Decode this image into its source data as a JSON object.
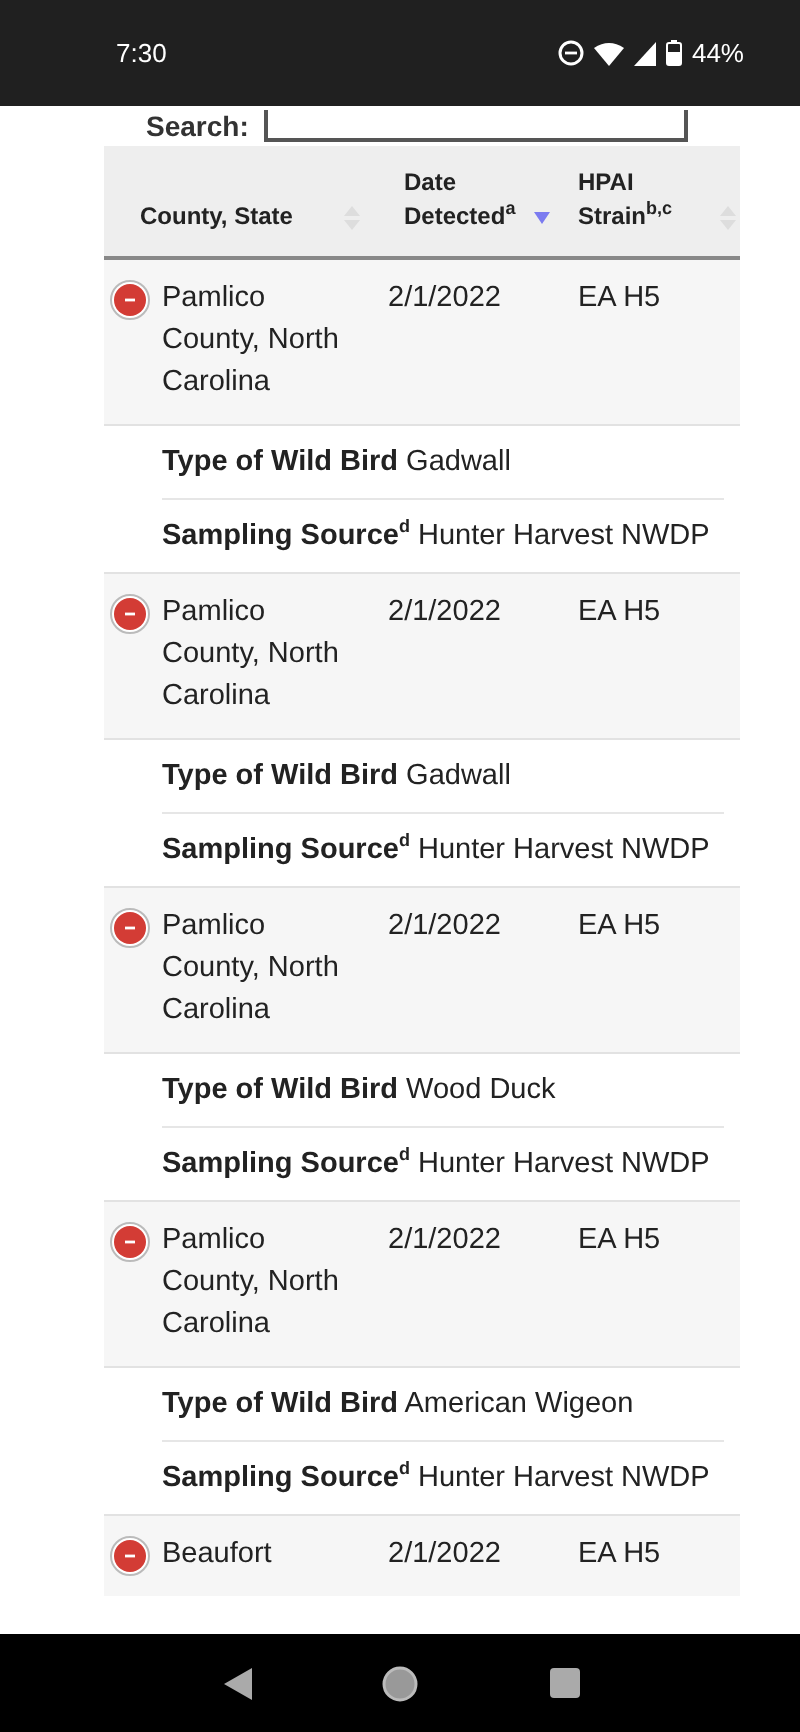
{
  "status_bar": {
    "time": "7:30",
    "battery": "44%"
  },
  "search": {
    "label": "Search:"
  },
  "table": {
    "columns": [
      {
        "label": "County, State",
        "sorted": false
      },
      {
        "label": "Date Detected$^{a}$",
        "sorted": true
      },
      {
        "label": "HPAI Strain$^{b,c}$",
        "sorted": false
      }
    ],
    "rows": [
      {
        "county": "Pamlico County, North Carolina",
        "date": "2/1/2022",
        "strain": "EA H5",
        "expanded": true,
        "details": [
          {
            "label": "Type of Wild Bird",
            "value": "Gadwall"
          },
          {
            "label": "Sampling Source$^{d}$",
            "value": "Hunter Harvest NWDP"
          }
        ]
      },
      {
        "county": "Pamlico County, North Carolina",
        "date": "2/1/2022",
        "strain": "EA H5",
        "expanded": true,
        "details": [
          {
            "label": "Type of Wild Bird",
            "value": "Gadwall"
          },
          {
            "label": "Sampling Source$^{d}$",
            "value": "Hunter Harvest NWDP"
          }
        ]
      },
      {
        "county": "Pamlico County, North Carolina",
        "date": "2/1/2022",
        "strain": "EA H5",
        "expanded": true,
        "details": [
          {
            "label": "Type of Wild Bird",
            "value": "Wood Duck"
          },
          {
            "label": "Sampling Source$^{d}$",
            "value": "Hunter Harvest NWDP"
          }
        ]
      },
      {
        "county": "Pamlico County, North Carolina",
        "date": "2/1/2022",
        "strain": "EA H5",
        "expanded": true,
        "details": [
          {
            "label": "Type of Wild Bird",
            "value": "American Wigeon"
          },
          {
            "label": "Sampling Source$^{d}$",
            "value": "Hunter Harvest NWDP"
          }
        ]
      },
      {
        "county": "Beaufort",
        "date": "2/1/2022",
        "strain": "EA H5",
        "expanded": true
      }
    ]
  }
}
